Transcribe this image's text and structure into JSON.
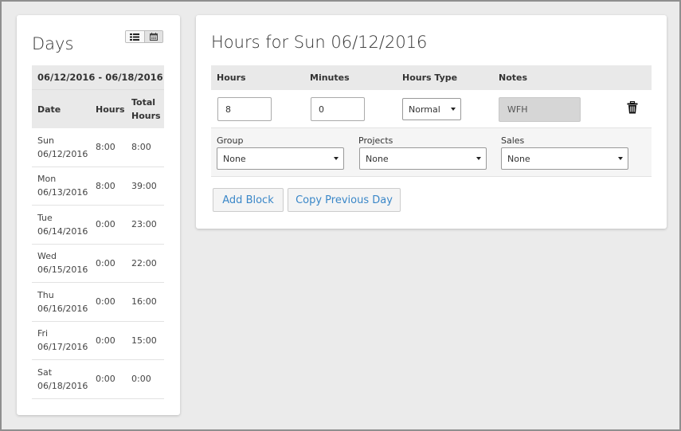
{
  "days_panel": {
    "title": "Days",
    "view_toggle": {
      "list_icon": "list-icon",
      "calendar_icon": "calendar-icon"
    },
    "range": "06/12/2016 - 06/18/2016",
    "columns": {
      "date": "Date",
      "hours": "Hours",
      "total_line1": "Total",
      "total_line2": "Hours"
    },
    "rows": [
      {
        "day": "Sun",
        "date": "06/12/2016",
        "hours": "8:00",
        "total": "8:00"
      },
      {
        "day": "Mon",
        "date": "06/13/2016",
        "hours": "8:00",
        "total": "39:00"
      },
      {
        "day": "Tue",
        "date": "06/14/2016",
        "hours": "0:00",
        "total": "23:00"
      },
      {
        "day": "Wed",
        "date": "06/15/2016",
        "hours": "0:00",
        "total": "22:00"
      },
      {
        "day": "Thu",
        "date": "06/16/2016",
        "hours": "0:00",
        "total": "16:00"
      },
      {
        "day": "Fri",
        "date": "06/17/2016",
        "hours": "0:00",
        "total": "15:00"
      },
      {
        "day": "Sat",
        "date": "06/18/2016",
        "hours": "0:00",
        "total": "0:00"
      }
    ]
  },
  "hours_panel": {
    "title": "Hours for Sun 06/12/2016",
    "columns": {
      "hours": "Hours",
      "minutes": "Minutes",
      "hours_type": "Hours Type",
      "notes": "Notes"
    },
    "entry": {
      "hours": "8",
      "minutes": "0",
      "hours_type": "Normal",
      "notes": "WFH",
      "delete_icon": "trash-icon"
    },
    "group": {
      "label": "Group",
      "value": "None"
    },
    "projects": {
      "label": "Projects",
      "value": "None"
    },
    "sales": {
      "label": "Sales",
      "value": "None"
    },
    "buttons": {
      "add_block": "Add Block",
      "copy_previous": "Copy Previous Day"
    }
  },
  "colors": {
    "background": "#ebebeb",
    "link_blue": "#3a87c8",
    "header_gray": "#e9e9e9"
  }
}
